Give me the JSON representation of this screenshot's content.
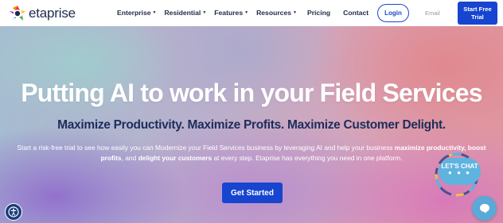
{
  "header": {
    "logo_text": "etaprise",
    "nav": [
      {
        "label": "Enterprise",
        "has_caret": true
      },
      {
        "label": "Residential",
        "has_caret": true
      },
      {
        "label": "Features",
        "has_caret": true
      },
      {
        "label": "Resources",
        "has_caret": true
      },
      {
        "label": "Pricing",
        "has_caret": false
      },
      {
        "label": "Contact",
        "has_caret": false
      }
    ],
    "login_label": "Login",
    "email_placeholder": "Email",
    "trial_line1": "Start Free",
    "trial_line2": "Trial"
  },
  "hero": {
    "headline": "Putting AI to work in your Field Services",
    "subheadline": "Maximize Productivity. Maximize Profits. Maximize Customer Delight.",
    "desc_part1": "Start a risk-free trial to see how easily you can Modernize your Field Services business by leveraging AI and help your business ",
    "desc_bold1": "maximize productivity, boost profits",
    "desc_part2": ", and ",
    "desc_bold2": "delight your customers",
    "desc_part3": " at every step. Etaprise has everything you need in one platform.",
    "cta_label": "Get Started"
  },
  "chat": {
    "bubble_label": "LET'S CHAT",
    "dots": "● ● ●"
  },
  "colors": {
    "brand_blue": "#1745d0",
    "navy_text": "#1e2d5c",
    "chat_blue": "#5fb3df"
  },
  "icons": [
    "etaprise-logo-icon",
    "caret-down-icon",
    "chat-icon",
    "accessibility-icon"
  ]
}
